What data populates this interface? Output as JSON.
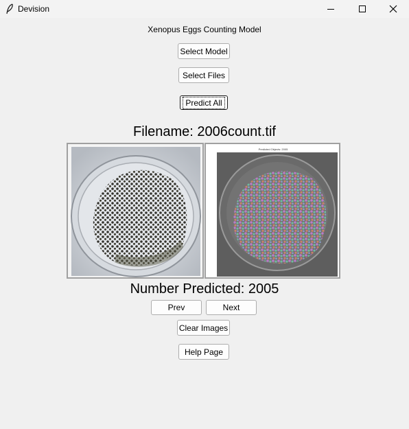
{
  "window": {
    "title": "Devision",
    "icons": {
      "app": "feather-icon",
      "minimize": "minimize-icon",
      "maximize": "maximize-icon",
      "close": "close-icon"
    }
  },
  "main": {
    "heading": "Xenopus Eggs Counting Model",
    "buttons": {
      "select_model": "Select Model",
      "select_files": "Select Files",
      "predict_all": "Predict All",
      "prev": "Prev",
      "next": "Next",
      "clear_images": "Clear Images",
      "help_page": "Help Page"
    },
    "filename_label": "Filename: 2006count.tif",
    "number_predicted_label": "Number Predicted: 2005",
    "images": {
      "original_alt": "petri-dish-with-xenopus-eggs",
      "predicted_caption": "Predicted Objects: 2005"
    }
  }
}
